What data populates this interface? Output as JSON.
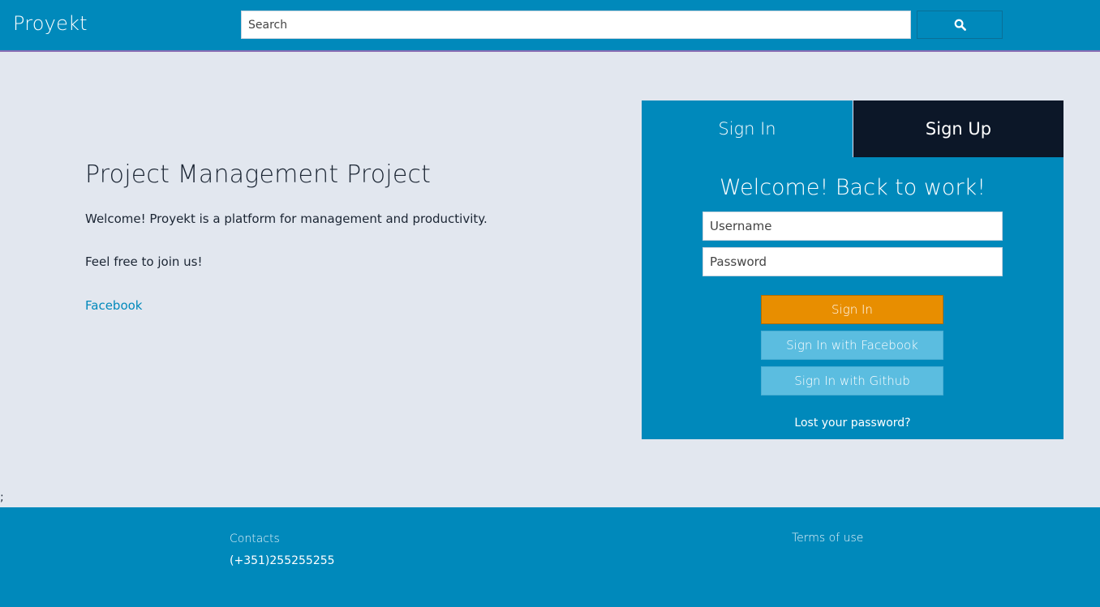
{
  "header": {
    "brand": "Proyekt",
    "search_placeholder": "Search",
    "search_button_icon": "search-icon"
  },
  "intro": {
    "title": "Project Management Project",
    "welcome_text": "Welcome! Proyekt is a platform for management and productivity.",
    "join_text": "Feel free to join us!",
    "facebook_link": "Facebook"
  },
  "login": {
    "tabs": [
      {
        "label": "Sign In",
        "active": true
      },
      {
        "label": "Sign Up",
        "active": false
      }
    ],
    "heading": "Welcome! Back to work!",
    "username_placeholder": "Username",
    "password_placeholder": "Password",
    "sign_in_button": "Sign In",
    "facebook_button": "Sign In with Facebook",
    "github_button": "Sign In with Github",
    "lost_password": "Lost your password?"
  },
  "stray_text": ";",
  "footer": {
    "contacts_heading": "Contacts",
    "phone": "(+351)255255255",
    "terms": "Terms of use"
  },
  "colors": {
    "primary": "#0089bb",
    "dark_tab": "#0c1728",
    "accent_orange": "#e88e00",
    "social_button": "#5bbde0",
    "page_background": "#e2e7ef"
  }
}
